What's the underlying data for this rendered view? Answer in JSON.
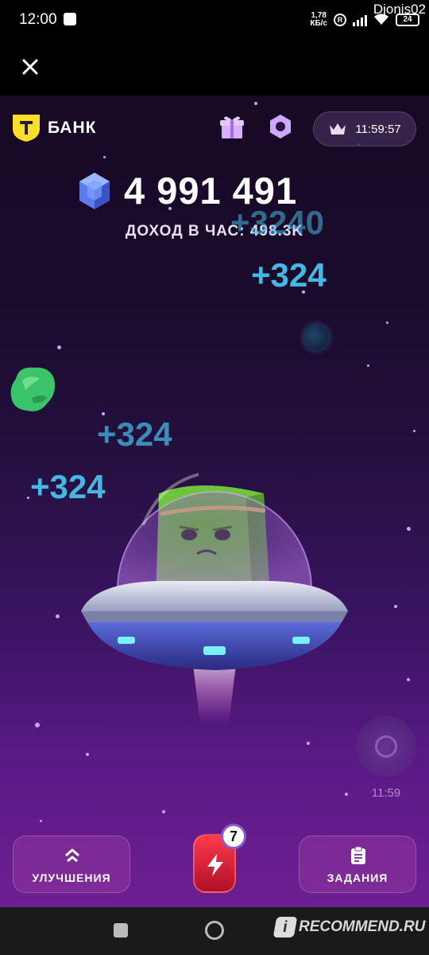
{
  "status_bar": {
    "time": "12:00",
    "network_speed_value": "1,78",
    "network_speed_unit": "КБ/с",
    "r_badge": "R",
    "battery": "24",
    "username": "Djonis02"
  },
  "brand": {
    "name": "БАНК",
    "logo_letter": "Т"
  },
  "header": {
    "timer": "11:59:57"
  },
  "balance": {
    "value": "4 991 491",
    "income_text": "ДОХОД В ЧАС: 498.3K"
  },
  "floating_rewards": [
    "+3240",
    "+324",
    "+324",
    "+324"
  ],
  "radar": {
    "time": "11:59"
  },
  "buttons": {
    "upgrades": "УЛУЧШЕНИЯ",
    "tasks": "ЗАДАНИЯ",
    "boost_count": "7"
  },
  "watermark": {
    "logo": "i",
    "text": "RECOMMEND.RU"
  },
  "colors": {
    "background_top": "#170a24",
    "background_bottom": "#6e1f92",
    "reward_text": "#44b8e2",
    "boost_red": "#ff3b4c",
    "brand_yellow": "#ffdd2d"
  }
}
